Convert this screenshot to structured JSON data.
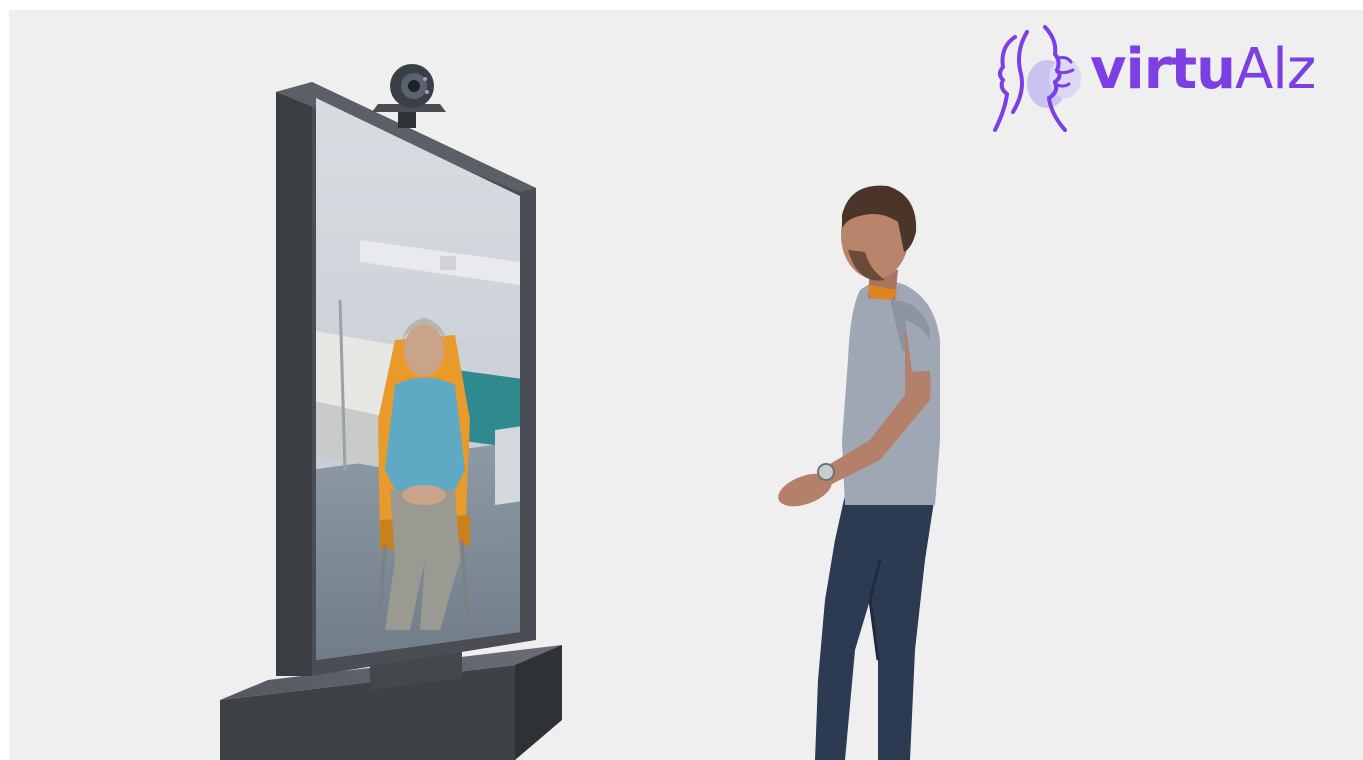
{
  "logo": {
    "text_bold": "virtu",
    "text_light": "Alz",
    "icon": "two-faces-logo-icon"
  },
  "colors": {
    "background": "#efefef",
    "brand_purple": "#7b3fe4",
    "brand_lavender": "#c9c3ef",
    "monitor_frame": "#4a4e54",
    "shirt": "#9ea7b3",
    "jeans": "#2c3a52",
    "patient_sweater": "#5fa9c4",
    "chair": "#e89a2a",
    "wall_teal": "#2f8a8f"
  }
}
